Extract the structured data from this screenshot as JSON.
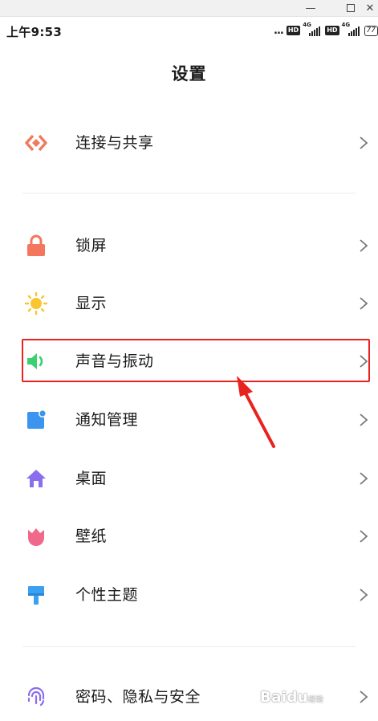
{
  "status_bar": {
    "time": "上午9:53",
    "dots": "...",
    "hd_label": "HD",
    "network_label": "4G",
    "battery": "77"
  },
  "page": {
    "title": "设置"
  },
  "settings": {
    "connect": {
      "label": "连接与共享",
      "icon": "connection-share-icon",
      "color": "#f07a5c"
    },
    "lock_screen": {
      "label": "锁屏",
      "icon": "lock-icon",
      "color": "#f4765e"
    },
    "display": {
      "label": "显示",
      "icon": "sun-icon",
      "color": "#f9c531"
    },
    "sound": {
      "label": "声音与振动",
      "icon": "speaker-icon",
      "color": "#3ccf74"
    },
    "notifications": {
      "label": "通知管理",
      "icon": "notification-icon",
      "color": "#3b95ef"
    },
    "desktop": {
      "label": "桌面",
      "icon": "home-icon",
      "color": "#8b6ef0"
    },
    "wallpaper": {
      "label": "壁纸",
      "icon": "tulip-icon",
      "color": "#f0698a"
    },
    "theme": {
      "label": "个性主题",
      "icon": "paintbrush-icon",
      "color": "#3aa1f2"
    },
    "privacy": {
      "label": "密码、隐私与安全",
      "icon": "fingerprint-icon",
      "color": "#8b6ef0"
    }
  },
  "annotation": {
    "highlight_color": "#e8231f"
  },
  "watermark": {
    "text": "Baidu",
    "sub": "经验"
  }
}
